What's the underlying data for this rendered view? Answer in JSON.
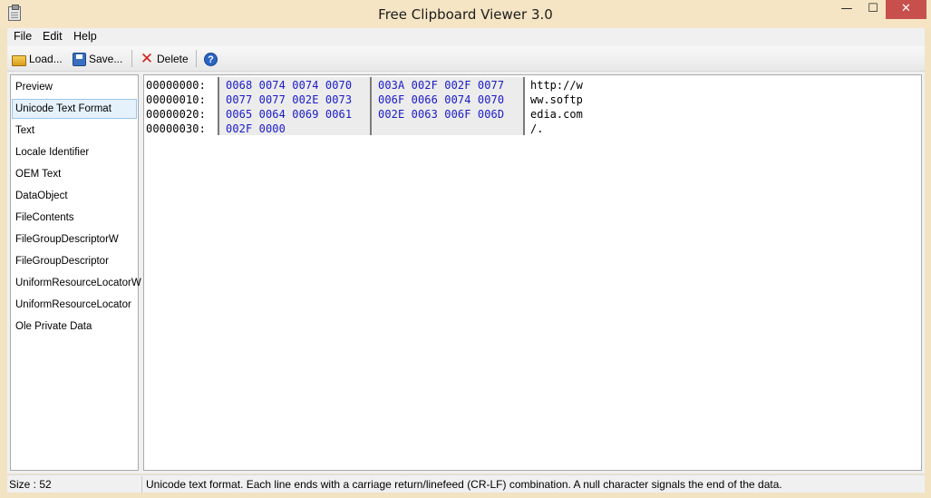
{
  "window": {
    "title": "Free Clipboard Viewer 3.0",
    "minimize": "—",
    "maximize": "☐",
    "close": "✕"
  },
  "menu": [
    "File",
    "Edit",
    "Help"
  ],
  "toolbar": {
    "load_label": "Load...",
    "save_label": "Save...",
    "delete_label": "Delete",
    "help_glyph": "?",
    "delete_glyph": "✕"
  },
  "formats": [
    "Preview",
    "Unicode Text Format",
    "Text",
    "Locale Identifier",
    "OEM Text",
    "DataObject",
    "FileContents",
    "FileGroupDescriptorW",
    "FileGroupDescriptor",
    "UniformResourceLocatorW",
    "UniformResourceLocator",
    "Ole Private Data"
  ],
  "selected_format": "Unicode Text Format",
  "hex": {
    "offsets": [
      "00000000:",
      "00000010:",
      "00000020:",
      "00000030:"
    ],
    "group1": [
      "0068 0074 0074 0070",
      "0077 0077 002E 0073",
      "0065 0064 0069 0061",
      "002F 0000"
    ],
    "group2": [
      "003A 002F 002F 0077",
      "006F 0066 0074 0070",
      "002E 0063 006F 006D",
      ""
    ],
    "ascii": [
      "http://w",
      "ww.softp",
      "edia.com",
      "/."
    ]
  },
  "status": {
    "size": "Size : 52",
    "description": "Unicode text format. Each line ends with a carriage return/linefeed (CR-LF) combination. A null character signals the end of the data."
  },
  "colors": {
    "hex_text": "#1a1ac8",
    "selection_bg": "#e5f1fb",
    "close_button": "#c7504d",
    "frame": "#f2e3c2"
  }
}
